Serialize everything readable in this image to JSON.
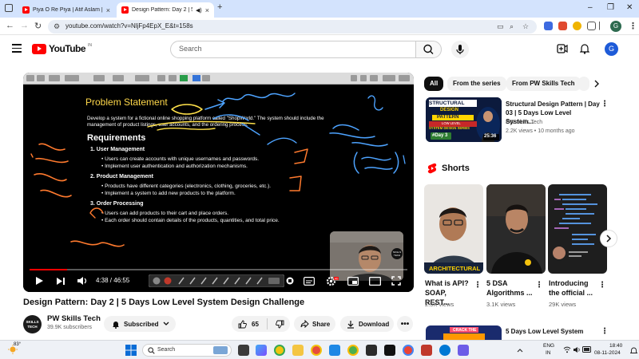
{
  "browser": {
    "tabs": [
      {
        "title": "Piya O Re Piya | Atif Aslam | Sh",
        "active": false
      },
      {
        "title": "Design Pattern: Day 2 | 5 D",
        "active": true
      }
    ],
    "new_tab": "+",
    "url": "youtube.com/watch?v=NljFp4EpX_E&t=158s",
    "profile_letter": "G"
  },
  "youtube": {
    "logo_text": "YouTube",
    "logo_region": "IN",
    "search_placeholder": "Search",
    "avatar_letter": "G"
  },
  "video": {
    "slide": {
      "title": "Problem Statement",
      "description": "Develop a system for a fictional online shopping platform called \"ShopWorld.\" The system should include the management of product listings, user accounts, and the ordering process.",
      "requirements_heading": "Requirements",
      "sections": [
        {
          "heading": "1. User Management",
          "bullets": [
            "Users can create accounts with unique usernames and passwords.",
            "Implement user authentication and authorization mechanisms."
          ]
        },
        {
          "heading": "2. Product Management",
          "bullets": [
            "Products have different categories (electronics, clothing, groceries, etc.).",
            "Implement a system to add new products to the platform."
          ]
        },
        {
          "heading": "3. Order Processing",
          "bullets": [
            "Users can add products to their cart and place orders.",
            "Each order should contain details of the products, quantities, and total price."
          ]
        }
      ]
    },
    "time": "4:38 / 46:55",
    "progress": 0.099,
    "title": "Design Pattern: Day 2 | 5 Days Low Level System Design Challenge"
  },
  "channel": {
    "name": "PW Skills Tech",
    "subscribers": "39.9K subscribers",
    "avatar_text": "SKILLS TECH",
    "subscribed_label": "Subscribed"
  },
  "actions": {
    "likes": "65",
    "share": "Share",
    "download": "Download"
  },
  "chips": [
    "All",
    "From the series",
    "From PW Skills Tech"
  ],
  "recommended": [
    {
      "title": "Structural Design Pattern | Day 03 | 5 Days Low Level System...",
      "channel": "PW Skills Tech",
      "meta": "2.2K views • 10 months ago",
      "duration": "25:36",
      "thumb_lines": [
        "STRUCTURAL",
        "DESIGN",
        "PATTERN",
        "LOW LEVEL",
        "SYSTEM DESIGN SERIES",
        "#Day 3"
      ]
    }
  ],
  "shorts": {
    "heading": "Shorts",
    "items": [
      {
        "title": "What is API? SOAP, REST...",
        "views": "2.5K views",
        "thumb_caption": "ARCHITECTURAL"
      },
      {
        "title": "5 DSA Algorithms ...",
        "views": "3.1K views"
      },
      {
        "title": "Introducing the official ...",
        "views": "29K views"
      }
    ]
  },
  "next_item": {
    "title": "5 Days Low Level System",
    "thumb_caption": "CRACK THE"
  },
  "taskbar": {
    "weather": "83°",
    "search": "Search",
    "lang": "ENG",
    "region": "IN",
    "time": "18:40",
    "date": "08-11-2024"
  },
  "colors": {
    "youtube_red": "#ff0000",
    "slide_title": "#ffd84a",
    "annotation_orange": "#ff7a2e",
    "annotation_blue": "#4da3ff",
    "annotation_yellow": "#ffe14a"
  }
}
